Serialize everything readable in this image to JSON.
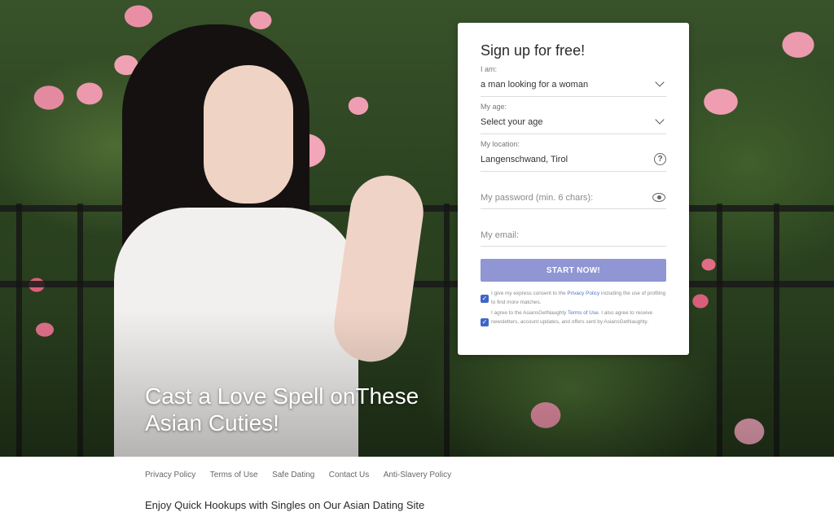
{
  "hero": {
    "heading_line1": "Cast a Love Spell onThese",
    "heading_line2": "Asian Cuties!"
  },
  "signup": {
    "title": "Sign up for free!",
    "i_am": {
      "label": "I am:",
      "value": "a man looking for a woman"
    },
    "age": {
      "label": "My age:",
      "value": "Select your age"
    },
    "location": {
      "label": "My location:",
      "value": "Langenschwand, Tirol"
    },
    "password": {
      "placeholder": "My password (min. 6 chars):"
    },
    "email": {
      "placeholder": "My email:"
    },
    "start_button": "START NOW!",
    "consent1": {
      "before": "I give my express consent to the ",
      "link": "Privacy Policy",
      "after": " including the use of profiling to find more matches."
    },
    "consent2": {
      "before": "I agree to the AsiansGetNaughty ",
      "link": "Terms of Use",
      "after": ". I also agree to receive newsletters, account updates, and offers sent by AsiansGetNaughty."
    },
    "accent_color": "#8f96d3"
  },
  "footer": {
    "links": [
      "Privacy Policy",
      "Terms of Use",
      "Safe Dating",
      "Contact Us",
      "Anti-Slavery Policy"
    ],
    "heading": "Enjoy Quick Hookups with Singles on Our Asian Dating Site"
  }
}
